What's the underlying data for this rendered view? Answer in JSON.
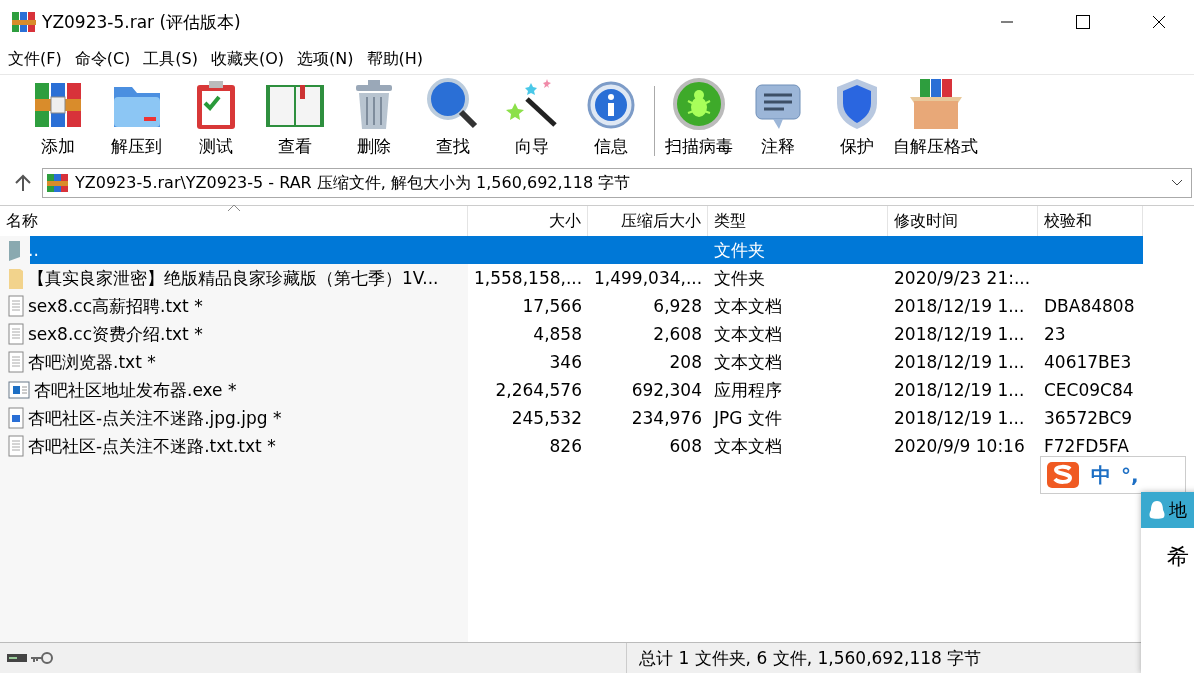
{
  "window": {
    "title": "YZ0923-5.rar (评估版本)"
  },
  "menu": [
    "文件(F)",
    "命令(C)",
    "工具(S)",
    "收藏夹(O)",
    "选项(N)",
    "帮助(H)"
  ],
  "toolbar": [
    {
      "label": "添加"
    },
    {
      "label": "解压到"
    },
    {
      "label": "测试"
    },
    {
      "label": "查看"
    },
    {
      "label": "删除"
    },
    {
      "label": "查找"
    },
    {
      "label": "向导"
    },
    {
      "label": "信息"
    },
    {
      "label": "扫描病毒"
    },
    {
      "label": "注释"
    },
    {
      "label": "保护"
    },
    {
      "label": "自解压格式"
    }
  ],
  "address": {
    "value": "YZ0923-5.rar\\YZ0923-5 - RAR 压缩文件, 解包大小为 1,560,692,118 字节"
  },
  "table": {
    "columns": [
      {
        "label": "名称",
        "sorted": true
      },
      {
        "label": "大小",
        "sorted": false
      },
      {
        "label": "压缩后大小",
        "sorted": false
      },
      {
        "label": "类型",
        "sorted": false
      },
      {
        "label": "修改时间",
        "sorted": false
      },
      {
        "label": "校验和",
        "sorted": false
      }
    ],
    "rows": [
      {
        "kind": "parent",
        "selected": true,
        "name": "..",
        "size": "",
        "packed": "",
        "type": "文件夹",
        "modified": "",
        "checksum": ""
      },
      {
        "kind": "folder",
        "selected": false,
        "name": "【真实良家泄密】绝版精品良家珍藏版（第七季）1V...",
        "size": "1,558,158,...",
        "packed": "1,499,034,...",
        "type": "文件夹",
        "modified": "2020/9/23 21:...",
        "checksum": ""
      },
      {
        "kind": "text",
        "selected": false,
        "name": "sex8.cc高薪招聘.txt *",
        "size": "17,566",
        "packed": "6,928",
        "type": "文本文档",
        "modified": "2018/12/19 1...",
        "checksum": "DBA84808"
      },
      {
        "kind": "text",
        "selected": false,
        "name": "sex8.cc资费介绍.txt *",
        "size": "4,858",
        "packed": "2,608",
        "type": "文本文档",
        "modified": "2018/12/19 1...",
        "checksum": "23"
      },
      {
        "kind": "text",
        "selected": false,
        "name": "杏吧浏览器.txt *",
        "size": "346",
        "packed": "208",
        "type": "文本文档",
        "modified": "2018/12/19 1...",
        "checksum": "40617BE3"
      },
      {
        "kind": "exe",
        "selected": false,
        "name": "杏吧社区地址发布器.exe *",
        "size": "2,264,576",
        "packed": "692,304",
        "type": "应用程序",
        "modified": "2018/12/19 1...",
        "checksum": "CEC09C84"
      },
      {
        "kind": "image",
        "selected": false,
        "name": "杏吧社区-点关注不迷路.jpg.jpg *",
        "size": "245,532",
        "packed": "234,976",
        "type": "JPG 文件",
        "modified": "2018/12/19 1...",
        "checksum": "36572BC9"
      },
      {
        "kind": "text",
        "selected": false,
        "name": "杏吧社区-点关注不迷路.txt.txt *",
        "size": "826",
        "packed": "608",
        "type": "文本文档",
        "modified": "2020/9/9 10:16",
        "checksum": "F72FD5FA"
      }
    ]
  },
  "status_bar": {
    "text": "总计 1 文件夹, 6 文件, 1,560,692,118 字节"
  },
  "ime_bar": {
    "mode": "中",
    "punct": "°,"
  },
  "chat_popup": {
    "title": "地",
    "body": "希"
  }
}
